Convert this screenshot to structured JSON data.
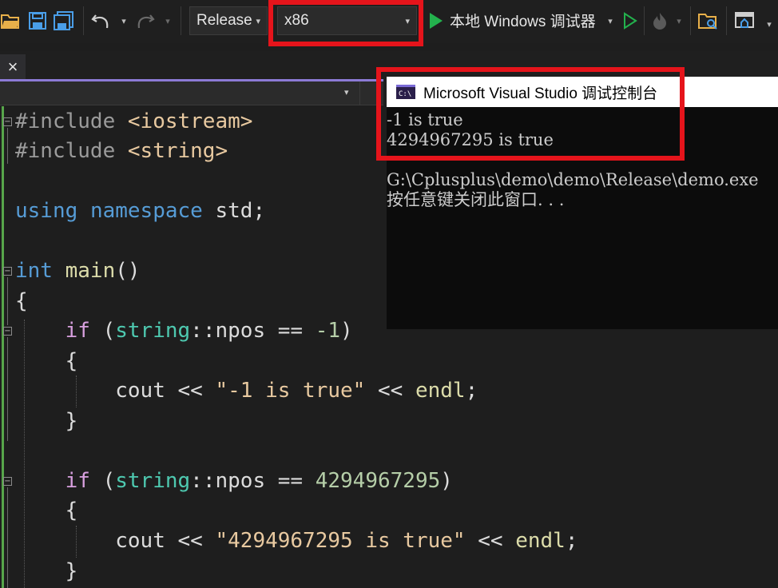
{
  "toolbar": {
    "configuration": "Release",
    "platform": "x86",
    "debugger": "本地 Windows 调试器",
    "caret": "▾"
  },
  "tab": {
    "close": "×"
  },
  "console": {
    "title": "Microsoft Visual Studio 调试控制台",
    "lines": [
      "-1 is true",
      "4294967295 is true",
      "",
      "G:\\Cplusplus\\demo\\demo\\Release\\demo.exe",
      "按任意键关闭此窗口. . ."
    ]
  },
  "code": {
    "l1": {
      "pre": "#include",
      "inc": "<iostream>"
    },
    "l2": {
      "pre": "#include",
      "inc": "<string>"
    },
    "l3": {
      "kw1": "using",
      "kw2": "namespace",
      "ns": "std;"
    },
    "l4": {
      "kw": "int",
      "fn": "main",
      "rest": "()"
    },
    "l5": {
      "brace": "{"
    },
    "l6": {
      "kw": "if",
      "open": "(",
      "type": "string",
      "op": "::npos ==",
      "num": "-1",
      "close": ")"
    },
    "l7": {
      "brace": "{"
    },
    "l8": {
      "id": "cout",
      "op1": "<<",
      "str": "\"-1 is true\"",
      "op2": "<<",
      "fn": "endl",
      "semi": ";"
    },
    "l9": {
      "brace": "}"
    },
    "l10": {
      "kw": "if",
      "open": "(",
      "type": "string",
      "op": "::npos ==",
      "num": "4294967295",
      "close": ")"
    },
    "l11": {
      "brace": "{"
    },
    "l12": {
      "id": "cout",
      "op1": "<<",
      "str": "\"4294967295 is true\"",
      "op2": "<<",
      "fn": "endl",
      "semi": ";"
    },
    "l13": {
      "brace": "}"
    }
  },
  "colors": {
    "highlight": "#e5141b",
    "accent": "#8c7ad6",
    "run": "#23b14d"
  }
}
